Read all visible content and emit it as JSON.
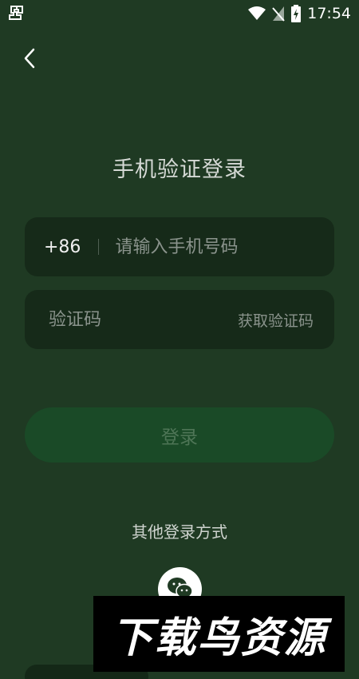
{
  "status_bar": {
    "left_icon": "bug-icon",
    "time": "17:54",
    "icons": [
      "wifi-icon",
      "no-signal-icon",
      "battery-charging-icon"
    ]
  },
  "header": {
    "back_icon": "chevron-left-icon"
  },
  "page": {
    "title": "手机验证登录"
  },
  "phone": {
    "country_code": "+86",
    "placeholder": "请输入手机号码"
  },
  "code": {
    "placeholder": "验证码",
    "get_code_label": "获取验证码"
  },
  "login": {
    "label": "登录"
  },
  "other": {
    "label": "其他登录方式",
    "wechat_icon": "wechat-icon"
  },
  "watermark": {
    "text": "下载鸟资源"
  },
  "colors": {
    "background": "#1f3a23",
    "field_bg": "#162a19",
    "login_bg": "#1a4a27"
  }
}
